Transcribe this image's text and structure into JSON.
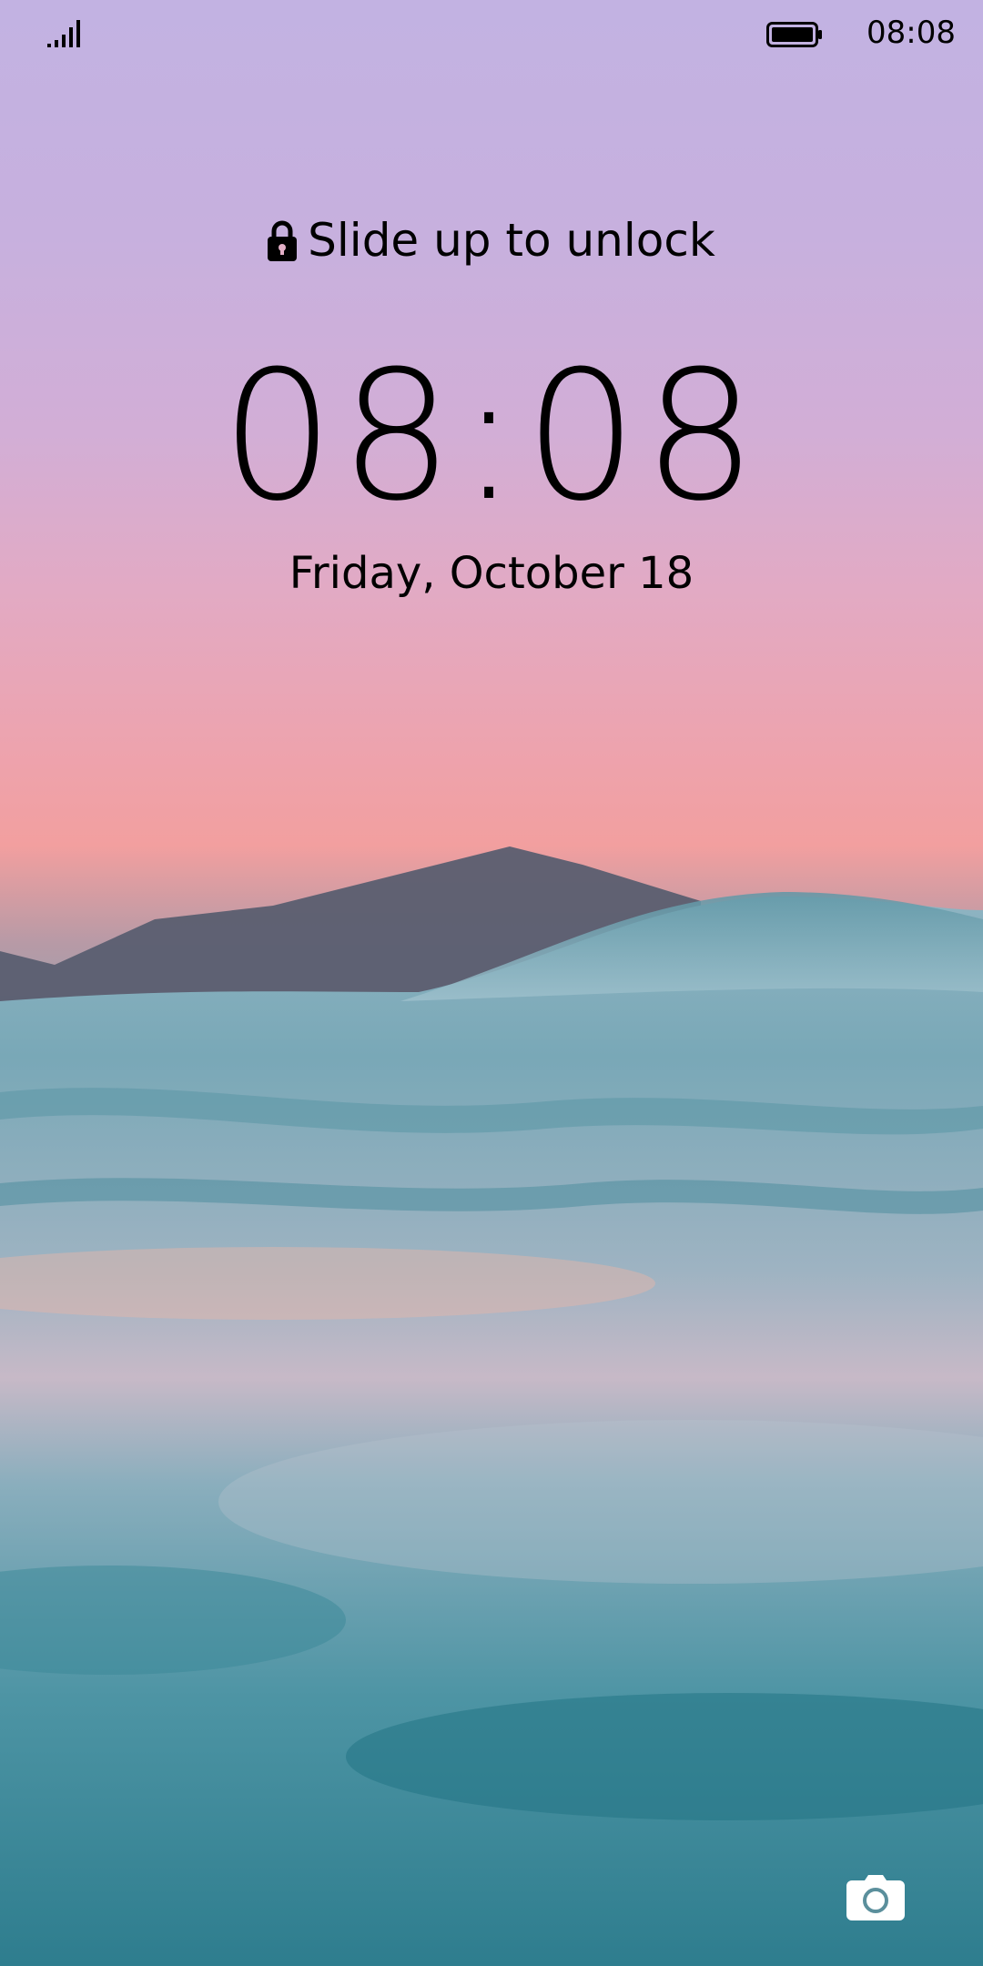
{
  "status_bar": {
    "signal_icon": "signal-strength-icon",
    "battery_icon": "battery-full-icon",
    "time": "08:08"
  },
  "lock_screen": {
    "unlock_icon": "lock-icon",
    "unlock_hint": "Slide up to unlock",
    "clock": "08:08",
    "date": "Friday, October 18",
    "camera_icon": "camera-icon"
  },
  "colors": {
    "text": "#000000",
    "sky_top": "#c2b2e2",
    "sky_horizon": "#f29f9f",
    "water": "#3f8c9b"
  }
}
